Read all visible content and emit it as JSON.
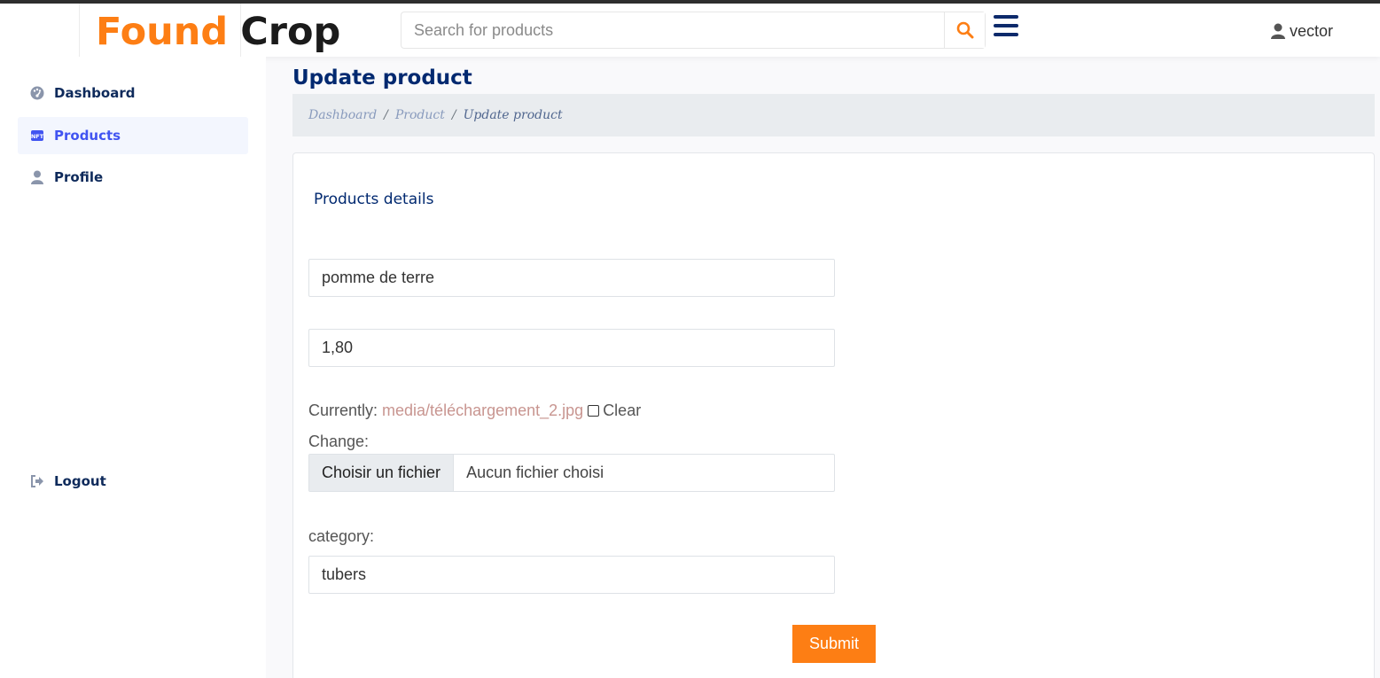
{
  "brand": {
    "part1": "Found",
    "part2": "Crop"
  },
  "header": {
    "search_placeholder": "Search for products",
    "username": "vector",
    "icons": [
      "search-icon",
      "hamburger-menu-icon",
      "user-icon"
    ]
  },
  "sidebar": {
    "items": [
      {
        "label": "Dashboard",
        "icon": "dashboard-icon",
        "active": false
      },
      {
        "label": "Products",
        "icon": "nft-icon",
        "active": true
      },
      {
        "label": "Profile",
        "icon": "user-icon",
        "active": false
      }
    ],
    "logout": {
      "label": "Logout",
      "icon": "logout-icon"
    }
  },
  "page": {
    "title": "Update product",
    "breadcrumb": [
      "Dashboard",
      "Product",
      "Update product"
    ]
  },
  "form": {
    "card_title": "Products details",
    "name_value": "pomme de terre",
    "price_value": "1,80",
    "currently_label": "Currently:",
    "current_file": "media/téléchargement_2.jpg",
    "clear_label": "Clear",
    "clear_checked": false,
    "change_label": "Change:",
    "file_button": "Choisir un fichier",
    "file_status": "Aucun fichier choisi",
    "category_label": "category:",
    "category_value": "tubers",
    "submit_label": "Submit"
  },
  "colors": {
    "accent": "#fd7e14",
    "navy": "#012970",
    "active_nav": "#4154f1",
    "link": "#c89590"
  }
}
